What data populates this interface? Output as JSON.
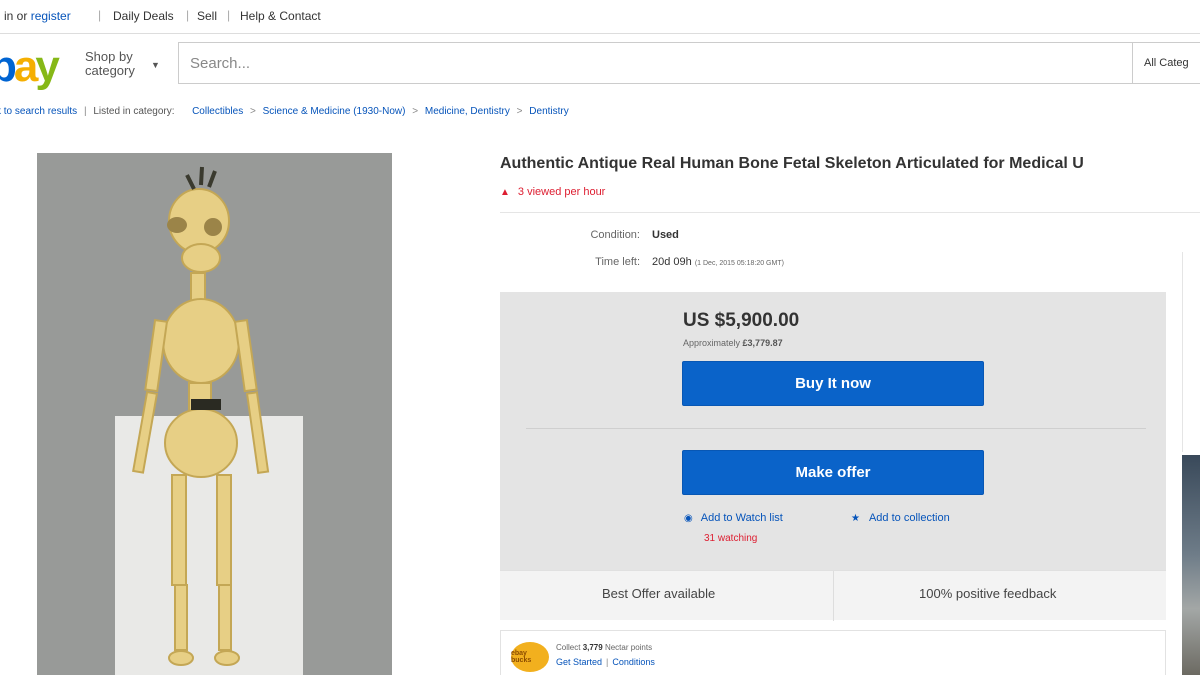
{
  "topbar": {
    "signin_text": "n in or",
    "register_link": "register",
    "daily_deals": "Daily Deals",
    "sell": "Sell",
    "help_contact": "Help & Contact"
  },
  "header": {
    "logo_letters": [
      "b",
      "a",
      "y"
    ],
    "shop_by_line1": "Shop by",
    "shop_by_line2": "category",
    "search_placeholder": "Search...",
    "category_select": "All Categ"
  },
  "breadcrumb": {
    "back": "k to search results",
    "listed_in": "Listed in category:",
    "path": [
      "Collectibles",
      "Science & Medicine (1930-Now)",
      "Medicine, Dentistry",
      "Dentistry"
    ]
  },
  "listing": {
    "title": "Authentic Antique Real Human Bone Fetal Skeleton Articulated for Medical U",
    "viewed_per_hour": "3 viewed per hour",
    "condition_label": "Condition:",
    "condition_value": "Used",
    "time_left_label": "Time left:",
    "time_left_value": "20d 09h",
    "time_left_detail": "(1 Dec, 2015   05:18:20 GMT)",
    "price": "US $5,900.00",
    "approx_label": "Approximately",
    "approx_value": "£3,779.87",
    "buy_now_label": "Buy It now",
    "make_offer_label": "Make offer",
    "add_watch_label": "Add to Watch list",
    "watching_count": "31 watching",
    "add_collection_label": "Add to collection",
    "best_offer": "Best Offer available",
    "positive_feedback": "100% positive feedback",
    "rewards_badge": "ebay bucks",
    "collect_label": "Collect",
    "collect_points": "3,779",
    "collect_suffix": "Nectar points",
    "get_started": "Get Started",
    "conditions": "Conditions"
  },
  "colors": {
    "accent_blue": "#0a63c9",
    "link_blue": "#0654ba",
    "alert_red": "#dd1e31",
    "logo_red": "#e53238",
    "logo_blue": "#0064d2",
    "logo_yellow": "#f5af02",
    "logo_green": "#86b817"
  },
  "icons": {
    "viewed": "flame-icon",
    "watch": "eye-icon",
    "collection": "star-icon",
    "dropdown": "chevron-down-icon"
  }
}
